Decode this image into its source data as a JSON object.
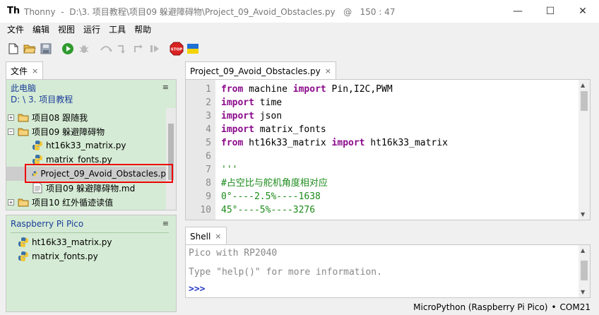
{
  "window": {
    "app_name": "Thonny",
    "path": "D:\\3. 项目教程\\项目09 躲避障碍物\\Project_09_Avoid_Obstacles.py",
    "at": "@",
    "cursor": "150 : 47",
    "controls": [
      "—",
      "☐",
      "✕"
    ]
  },
  "menu": [
    "文件",
    "编辑",
    "视图",
    "运行",
    "工具",
    "帮助"
  ],
  "toolbar": {
    "icons": [
      "new-file-icon",
      "open-file-icon",
      "save-icon",
      "run-icon",
      "debug-icon",
      "step-over-icon",
      "step-into-icon",
      "step-out-icon",
      "resume-icon",
      "stop-icon",
      "ukraine-flag-icon"
    ],
    "stop_label": "STOP"
  },
  "files_tab": {
    "label": "文件",
    "close": "×"
  },
  "files": {
    "pc_label": "此电脑",
    "pc_path": "D: \\ 3. 项目教程",
    "menu_glyph": "≡",
    "tree": [
      {
        "expander": "+",
        "icon": "folder-icon",
        "label": "项目08 跟随我"
      },
      {
        "expander": "−",
        "icon": "folder-icon",
        "label": "项目09 躲避障碍物"
      },
      {
        "expander": "",
        "icon": "python-file-icon",
        "label": "ht16k33_matrix.py"
      },
      {
        "expander": "",
        "icon": "python-file-icon",
        "label": "matrix_fonts.py"
      },
      {
        "expander": "",
        "icon": "python-file-icon",
        "label": "Project_09_Avoid_Obstacles.p"
      },
      {
        "expander": "",
        "icon": "text-file-icon",
        "label": "项目09 躲避障碍物.md"
      },
      {
        "expander": "+",
        "icon": "folder-icon",
        "label": "项目10 红外循迹读值"
      }
    ]
  },
  "pico": {
    "label": "Raspberry Pi Pico",
    "menu_glyph": "≡",
    "files": [
      "ht16k33_matrix.py",
      "matrix_fonts.py"
    ]
  },
  "editor_tab": {
    "label": "Project_09_Avoid_Obstacles.py",
    "close": "×"
  },
  "editor": {
    "line_numbers": [
      "1",
      "2",
      "3",
      "4",
      "5",
      "6",
      "7",
      "8",
      "9",
      "10"
    ],
    "lines": [
      [
        {
          "t": "from",
          "c": "kw"
        },
        {
          "t": " machine "
        },
        {
          "t": "import",
          "c": "kw"
        },
        {
          "t": " Pin,I2C,PWM"
        }
      ],
      [
        {
          "t": "import",
          "c": "kw"
        },
        {
          "t": " time"
        }
      ],
      [
        {
          "t": "import",
          "c": "kw"
        },
        {
          "t": " json"
        }
      ],
      [
        {
          "t": "import",
          "c": "kw"
        },
        {
          "t": " matrix_fonts"
        }
      ],
      [
        {
          "t": "from",
          "c": "kw"
        },
        {
          "t": " ht16k33_matrix "
        },
        {
          "t": "import",
          "c": "kw"
        },
        {
          "t": " ht16k33_matrix"
        }
      ],
      [],
      [
        {
          "t": "'''",
          "c": "str"
        }
      ],
      [
        {
          "t": "#占空比与舵机角度相对应",
          "c": "str"
        }
      ],
      [
        {
          "t": "0°----2.5%----1638",
          "c": "str"
        }
      ],
      [
        {
          "t": "45°----5%----3276",
          "c": "str"
        }
      ]
    ]
  },
  "shell_tab": {
    "label": "Shell",
    "close": "×"
  },
  "shell": {
    "lines": [
      "Pico with RP2040",
      "Type \"help()\" for more information."
    ],
    "prompt": ">>>"
  },
  "status": {
    "interpreter": "MicroPython (Raspberry Pi Pico)",
    "separator": "•",
    "port": "COM21"
  },
  "colors": {
    "panel_bg": "#d5ebd5",
    "header_blue": "#1a3d99",
    "keyword": "#8b0a8b",
    "string": "#1a8a1a",
    "highlight": "#ee0000"
  }
}
